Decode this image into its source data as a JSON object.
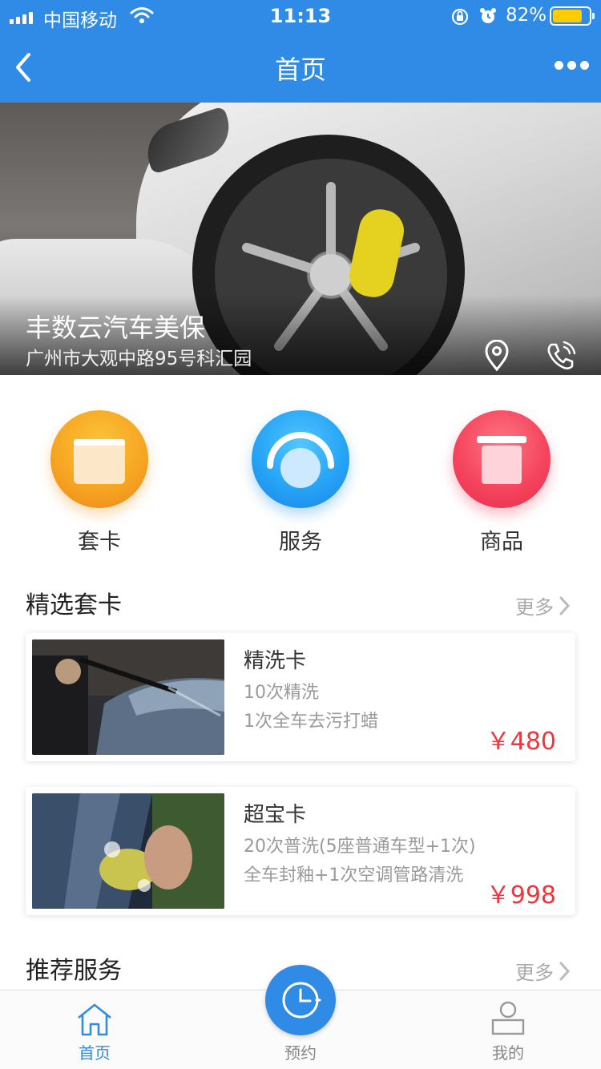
{
  "status_bar": {
    "carrier": "中国移动",
    "time": "11:13",
    "battery": "82%",
    "battery_level": 0.82
  },
  "nav": {
    "title": "首页",
    "back_icon": "chevron-left-icon",
    "more_icon": "more-dots-icon"
  },
  "shop": {
    "name": "丰数云汽车美保",
    "address": "广州市大观中路95号科汇园",
    "location_icon": "location-pin-icon",
    "phone_icon": "phone-icon"
  },
  "categories": [
    {
      "label": "套卡",
      "icon": "card-icon",
      "color": "#f6a623"
    },
    {
      "label": "服务",
      "icon": "service-gauge-icon",
      "color": "#26a4f5"
    },
    {
      "label": "商品",
      "icon": "trash-box-icon",
      "color": "#f5465e"
    }
  ],
  "featured": {
    "title": "精选套卡",
    "more": "更多",
    "cards": [
      {
        "name": "精洗卡",
        "line1": "10次精洗",
        "line2": "1次全车去污打蜡",
        "price": "￥480"
      },
      {
        "name": "超宝卡",
        "line1": "20次普洗(5座普通车型+1次)",
        "line2": "全车封釉+1次空调管路清洗",
        "price": "￥998"
      }
    ]
  },
  "recommended": {
    "title": "推荐服务",
    "more": "更多"
  },
  "tabbar": {
    "home": "首页",
    "booking": "预约",
    "mine": "我的"
  },
  "colors": {
    "primary": "#2f8be6",
    "price": "#f2343c",
    "muted": "#9a9a9a"
  }
}
